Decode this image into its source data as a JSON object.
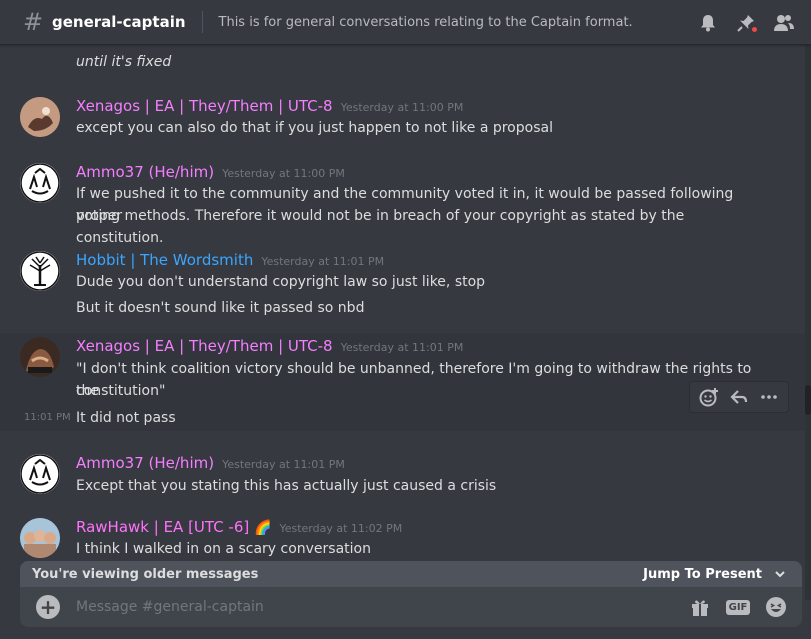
{
  "header": {
    "channel_name": "general-captain",
    "topic": "This is for general conversations relating to the Captain format."
  },
  "messages": [
    {
      "continuation_text": "until it's fixed"
    },
    {
      "author": "Xenagos | EA | They/Them | UTC-8",
      "timestamp": "Yesterday at 11:00 PM",
      "lines": [
        "except you can also do that if you just happen to not like a proposal"
      ]
    },
    {
      "author": "Ammo37 (He/him)",
      "timestamp": "Yesterday at 11:00 PM",
      "lines": [
        "If we pushed it to the community and the community voted it in, it would be passed following proper",
        "voting methods.  Therefore it would not be in breach of your copyright as stated by the constitution."
      ]
    },
    {
      "author": "Hobbit | The Wordsmith",
      "timestamp": "Yesterday at 11:01 PM",
      "lines": [
        "Dude you don't understand copyright law so just like, stop",
        "But it doesn't sound like it passed so nbd"
      ]
    },
    {
      "author": "Xenagos | EA | They/Them | UTC-8",
      "timestamp": "Yesterday at 11:01 PM",
      "lines": [
        "\"I don't think coalition victory should be unbanned, therefore I'm going to withdraw the rights to the",
        "constitution\""
      ],
      "followup_time": "11:01 PM",
      "followup_text": "It did not pass"
    },
    {
      "author": "Ammo37 (He/him)",
      "timestamp": "Yesterday at 11:01 PM",
      "lines": [
        "Except that you stating this has actually just caused a crisis"
      ]
    },
    {
      "author": "RawHawk | EA [UTC -6]",
      "author_emoji": "🌈",
      "timestamp": "Yesterday at 11:02 PM",
      "lines": [
        "I think I walked in on a scary conversation"
      ]
    }
  ],
  "older_bar": {
    "text": "You're viewing older messages",
    "jump_label": "Jump To Present"
  },
  "composer": {
    "placeholder": "Message #general-captain",
    "gif_label": "GIF"
  },
  "colors": {
    "background": "#36393f",
    "role_pink": "#f47fff",
    "role_blue": "#3ba6ff"
  },
  "icons": [
    "hash-icon",
    "bell-icon",
    "pin-icon",
    "members-icon",
    "add-reaction-icon",
    "reply-icon",
    "more-icon",
    "plus-icon",
    "gift-icon",
    "gif-icon",
    "emoji-icon",
    "chevron-down-icon"
  ]
}
